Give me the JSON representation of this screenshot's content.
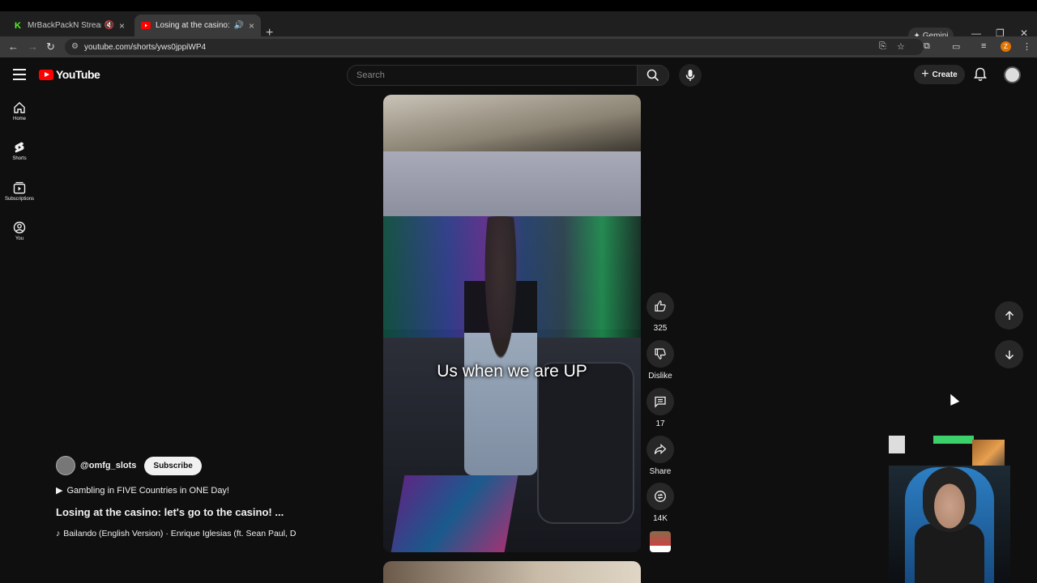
{
  "browser": {
    "tabs": [
      {
        "title": "MrBackPackN Stream - Wa",
        "favicon": "K",
        "favicon_color": "#53fc18",
        "muted": true
      },
      {
        "title": "Losing at the casino: let's g",
        "favicon": "youtube",
        "favicon_color": "#ff0000",
        "audio": true
      }
    ],
    "gemini_label": "Gemini",
    "url": "youtube.com/shorts/yws0jppiWP4",
    "profile_initial": "Z"
  },
  "youtube": {
    "logo_text": "YouTube",
    "search_placeholder": "Search",
    "create_label": "Create",
    "sidebar": [
      {
        "label": "Home",
        "icon": "home-icon"
      },
      {
        "label": "Shorts",
        "icon": "shorts-icon"
      },
      {
        "label": "Subscriptions",
        "icon": "subscriptions-icon"
      },
      {
        "label": "You",
        "icon": "you-icon"
      }
    ]
  },
  "short": {
    "caption": "Us when we are UP",
    "channel": "@omfg_slots",
    "subscribe_label": "Subscribe",
    "playlist": "Gambling in FIVE Countries in ONE Day!",
    "title": "Losing at the casino: let's go to the casino! ...",
    "song": "Bailando (English Version) · Enrique Iglesias (ft. Sean Paul, D",
    "actions": {
      "likes": "325",
      "dislike_label": "Dislike",
      "comments": "17",
      "share_label": "Share",
      "remix": "14K"
    }
  },
  "colors": {
    "background": "#0f0f0f",
    "youtube_red": "#ff0000",
    "button_bg": "#272727"
  }
}
